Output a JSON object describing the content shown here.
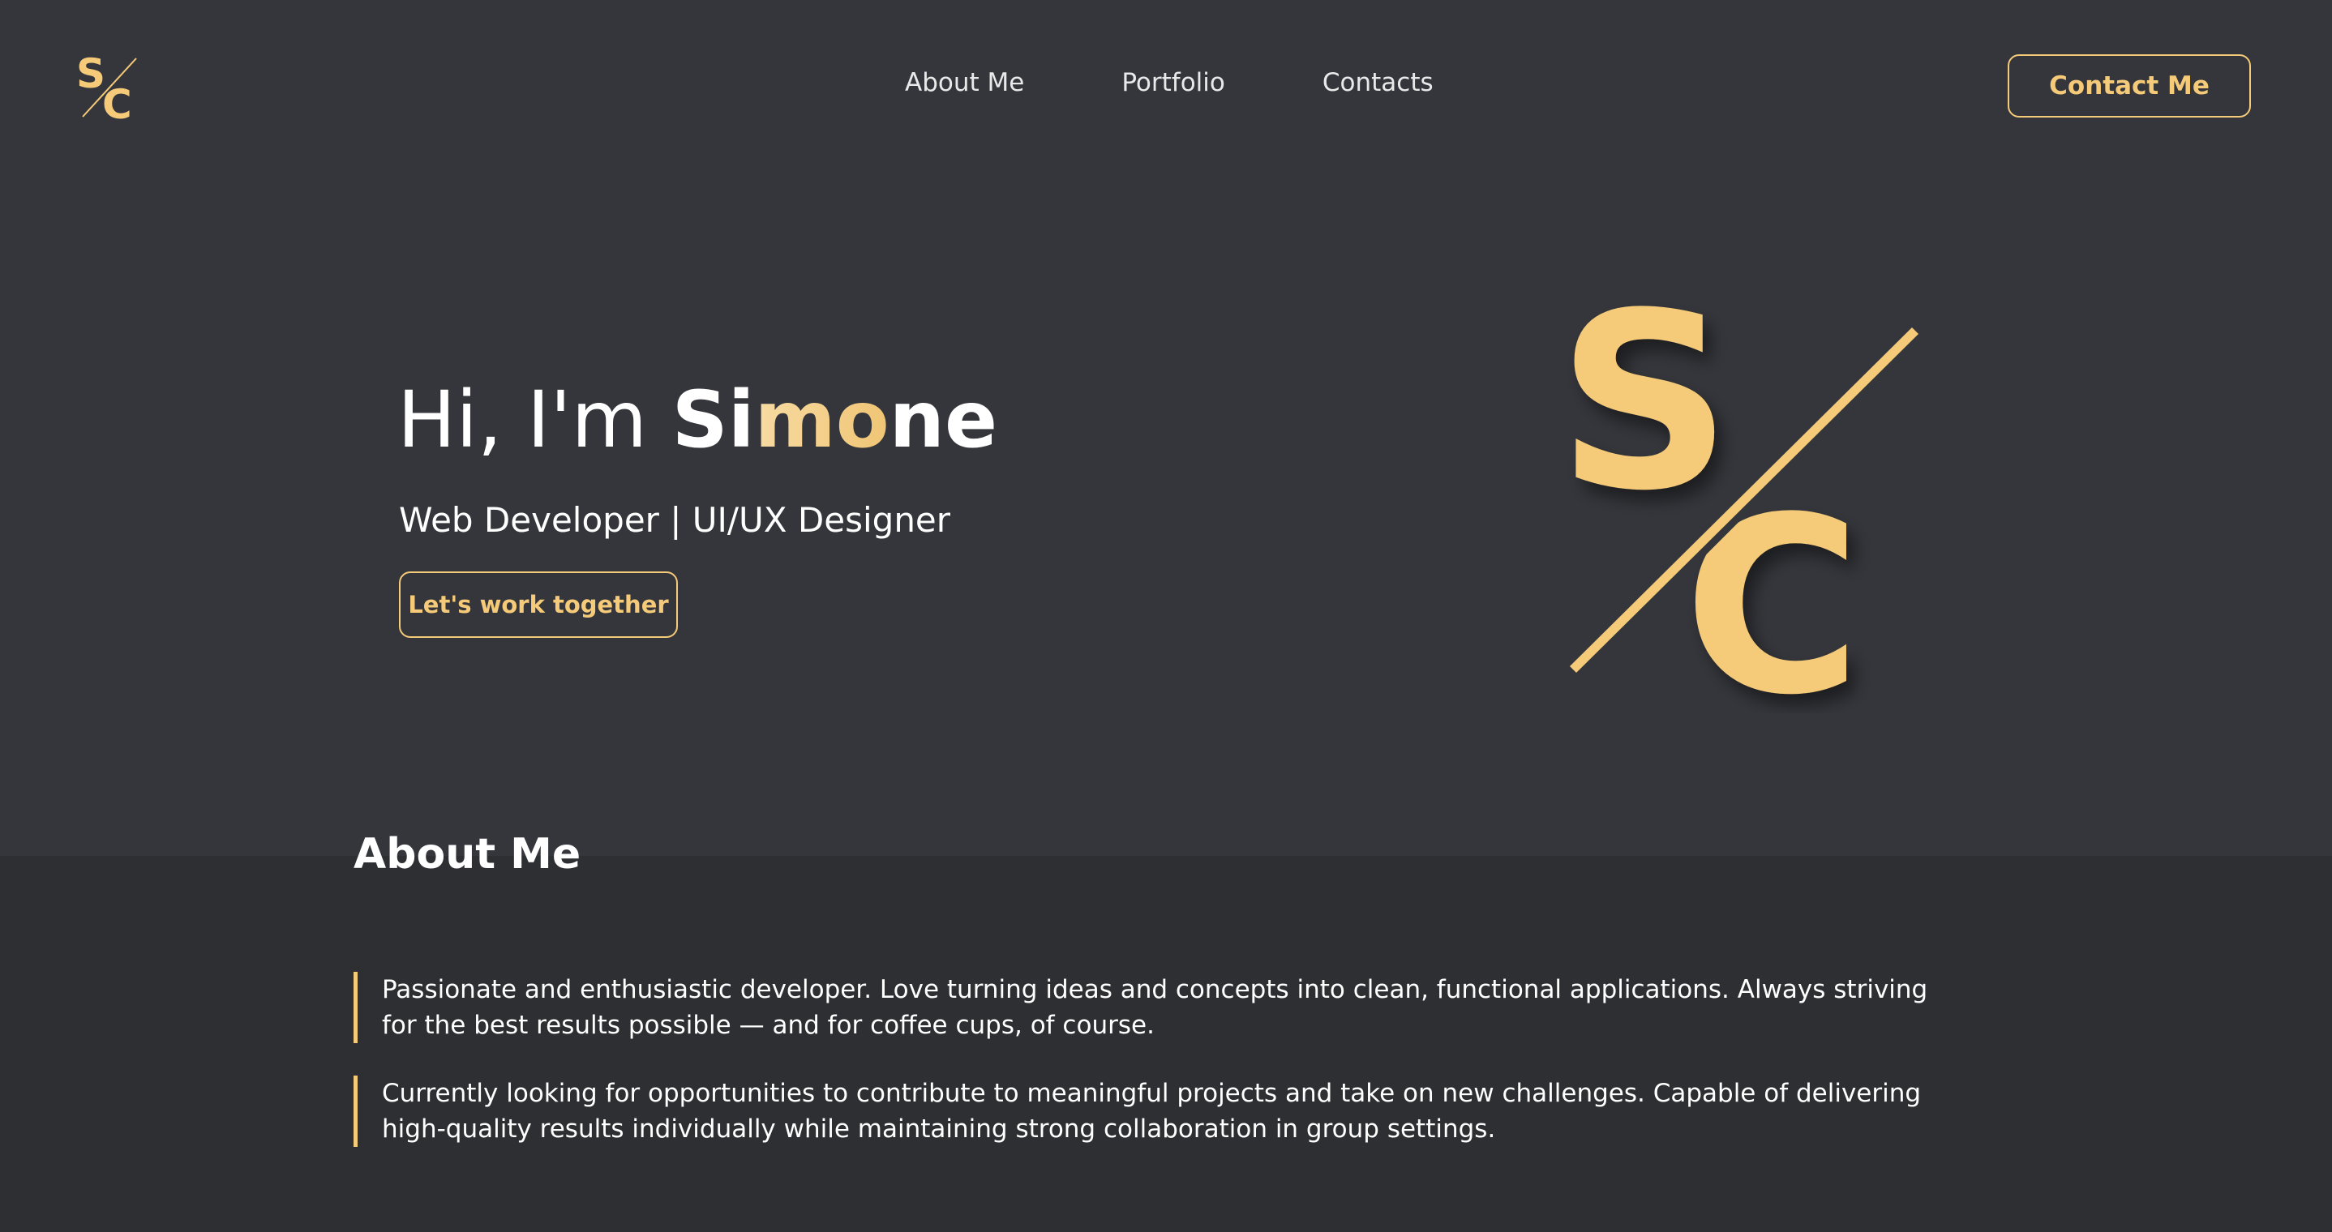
{
  "header": {
    "logo_icon": "sc-monogram-icon",
    "nav": [
      {
        "label": "About Me"
      },
      {
        "label": "Portfolio"
      },
      {
        "label": "Contacts"
      }
    ],
    "contact_button": "Contact Me"
  },
  "hero": {
    "greeting": "Hi, I'm ",
    "name_parts": [
      "Si",
      "mo",
      "ne"
    ],
    "subtitle": "Web Developer | UI/UX Designer",
    "cta": "Let's work together",
    "logo_icon": "sc-monogram-icon"
  },
  "about": {
    "title": "About Me",
    "paragraphs": [
      "Passionate and enthusiastic developer. Love turning ideas and concepts into clean, functional applications. Always striving for the best results possible — and for coffee cups, of course.",
      "Currently looking for opportunities to contribute to meaningful projects and take on new challenges. Capable of delivering high-quality results individually while maintaining strong collaboration in group settings."
    ]
  },
  "colors": {
    "background": "#35363b",
    "section_background": "#2e2f33",
    "accent": "#f5ca78",
    "text": "#ffffff"
  }
}
